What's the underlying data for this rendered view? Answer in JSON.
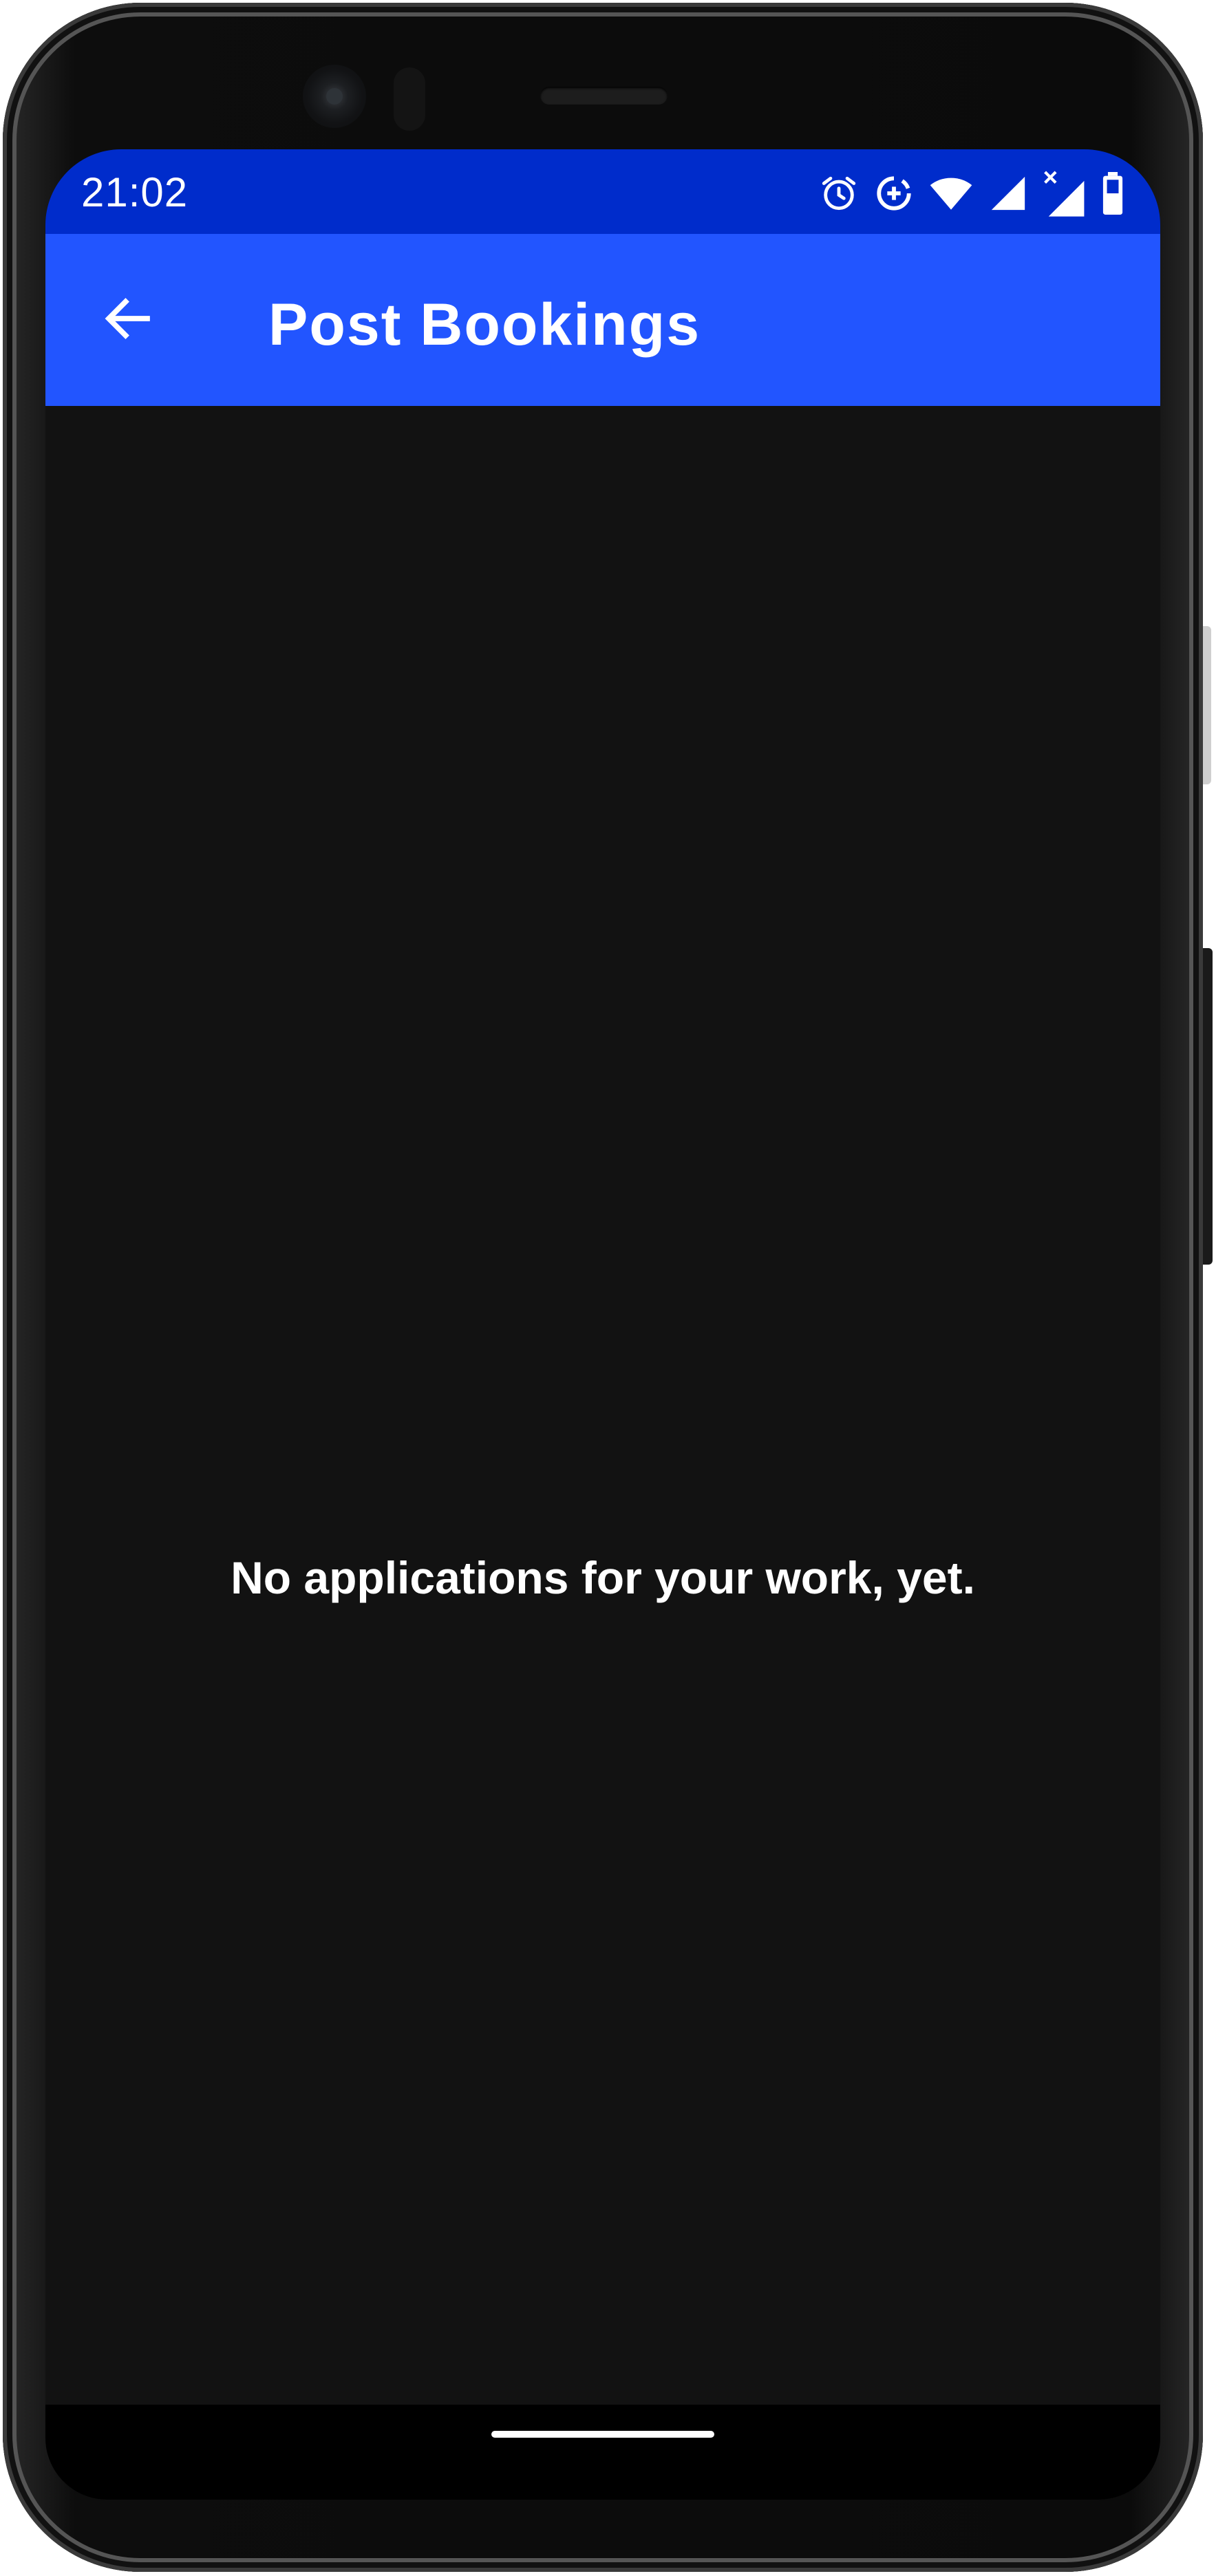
{
  "status_bar": {
    "time": "21:02",
    "icons": [
      "alarm-icon",
      "data-saver-icon",
      "wifi-icon",
      "signal-icon",
      "signal-no-data-icon",
      "battery-icon"
    ]
  },
  "app_bar": {
    "title": "Post Bookings",
    "back_icon": "arrow-left-icon"
  },
  "content": {
    "empty_message": "No applications for your work, yet."
  },
  "colors": {
    "status_bar": "#002ccb",
    "app_bar": "#2255ff",
    "background": "#121212",
    "text": "#ffffff"
  }
}
